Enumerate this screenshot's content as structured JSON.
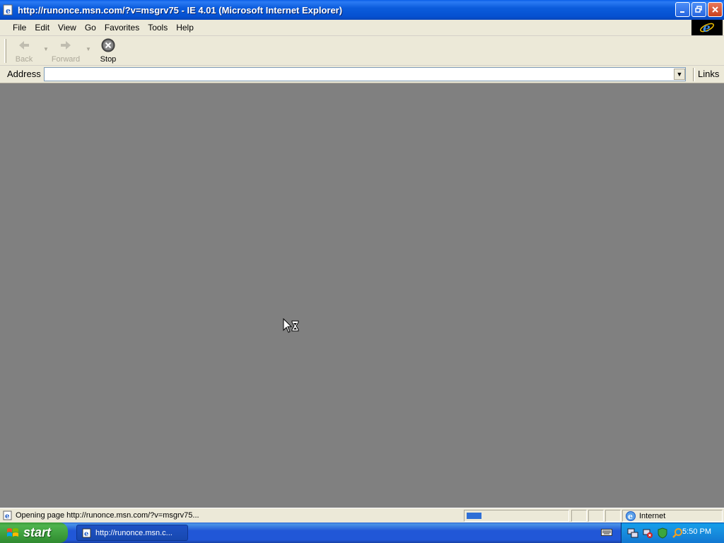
{
  "window": {
    "title": "http://runonce.msn.com/?v=msgrv75 - IE 4.01 (Microsoft Internet Explorer)"
  },
  "menu": {
    "items": [
      {
        "label": "File",
        "key": "F",
        "rest": "ile"
      },
      {
        "label": "Edit",
        "key": "E",
        "rest": "dit"
      },
      {
        "label": "View",
        "key": "V",
        "rest": "iew"
      },
      {
        "label": "Go",
        "key": "G",
        "rest": "o"
      },
      {
        "label": "Favorites",
        "key": "F",
        "rest": "avorites",
        "prefix": "F"
      },
      {
        "label": "Tools",
        "key": "T",
        "rest": "ools"
      },
      {
        "label": "Help",
        "key": "H",
        "rest": "elp"
      }
    ]
  },
  "toolbar": {
    "back_label": "Back",
    "forward_label": "Forward",
    "stop_label": "Stop"
  },
  "address": {
    "label": "Address",
    "value": "",
    "links_label": "Links"
  },
  "status": {
    "text": "Opening page http://runonce.msn.com/?v=msgrv75...",
    "zone": "Internet",
    "progress": 0.15
  },
  "taskbar": {
    "start_label": "start",
    "task_label": "http://runonce.msn.c...",
    "clock": "5:50 PM"
  },
  "colors": {
    "titlebar": "#0A5FE8",
    "content_bg": "#808080",
    "chrome": "#ECE9D8",
    "taskbar": "#2157D7",
    "start": "#3D9E3D"
  }
}
